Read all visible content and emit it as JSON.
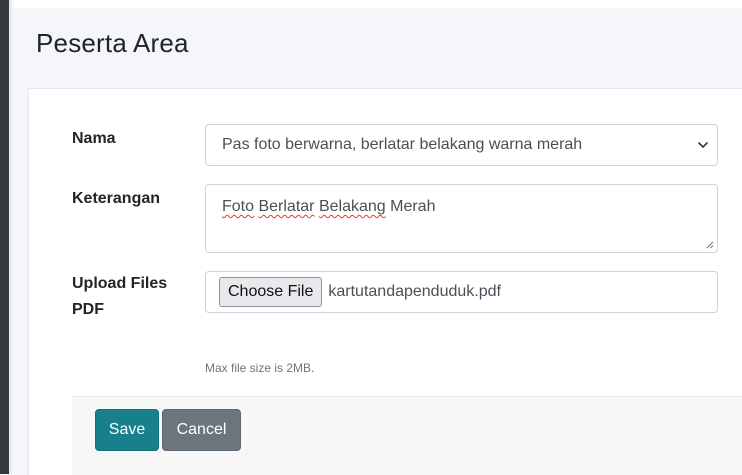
{
  "page": {
    "title": "Peserta Area"
  },
  "form": {
    "nama": {
      "label": "Nama",
      "selected": "Pas foto berwarna, berlatar belakang warna merah"
    },
    "keterangan": {
      "label": "Keterangan",
      "value": "Foto Berlatar Belakang Merah",
      "value_parts": [
        "Foto",
        " ",
        "Berlatar",
        " ",
        "Belakang",
        " Merah"
      ]
    },
    "upload": {
      "label_line1": "Upload Files",
      "label_line2": "PDF",
      "button_label": "Choose File",
      "file_name": "kartutandapenduduk.pdf",
      "help_text": "Max file size is 2MB."
    }
  },
  "actions": {
    "save_label": "Save",
    "cancel_label": "Cancel"
  },
  "icons": {
    "select_arrow": "chevron-down-icon",
    "textarea_resize": "resize-grip-icon"
  },
  "colors": {
    "save_button": "#17808b",
    "cancel_button": "#6c757d",
    "sidebar": "#343a40",
    "spellcheck_underline": "#e53935"
  }
}
